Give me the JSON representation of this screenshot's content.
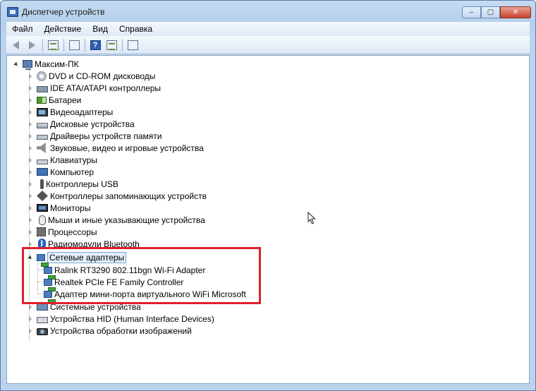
{
  "window": {
    "title": "Диспетчер устройств",
    "controls": {
      "minimize": "‒",
      "maximize": "▢",
      "close": "✕"
    }
  },
  "menu": [
    {
      "label": "Файл"
    },
    {
      "label": "Действие"
    },
    {
      "label": "Вид"
    },
    {
      "label": "Справка"
    }
  ],
  "toolbar": {
    "buttons": [
      "back-icon",
      "forward-icon",
      "show-hide-console-tree-icon",
      "properties-icon",
      "help-icon",
      "action-pane-icon",
      "scan-hardware-icon"
    ]
  },
  "tree": {
    "root": {
      "label": "Максим-ПК",
      "icon": "computer-icon"
    },
    "categories": [
      {
        "label": "DVD и CD-ROM дисководы",
        "icon": "dvd-drive-icon"
      },
      {
        "label": "IDE ATA/ATAPI контроллеры",
        "icon": "ide-controller-icon"
      },
      {
        "label": "Батареи",
        "icon": "battery-icon"
      },
      {
        "label": "Видеоадаптеры",
        "icon": "display-adapter-icon"
      },
      {
        "label": "Дисковые устройства",
        "icon": "disk-drive-icon"
      },
      {
        "label": "Драйверы устройств памяти",
        "icon": "memory-driver-icon"
      },
      {
        "label": "Звуковые, видео и игровые устройства",
        "icon": "sound-icon"
      },
      {
        "label": "Клавиатуры",
        "icon": "keyboard-icon"
      },
      {
        "label": "Компьютер",
        "icon": "pc-icon"
      },
      {
        "label": "Контроллеры USB",
        "icon": "usb-icon"
      },
      {
        "label": "Контроллеры запоминающих устройств",
        "icon": "storage-controller-icon"
      },
      {
        "label": "Мониторы",
        "icon": "monitor-icon"
      },
      {
        "label": "Мыши и иные указывающие устройства",
        "icon": "mouse-icon"
      },
      {
        "label": "Процессоры",
        "icon": "processor-icon"
      },
      {
        "label": "Радиомодули Bluetooth",
        "icon": "bluetooth-icon"
      }
    ],
    "network": {
      "label": "Сетевые адаптеры",
      "icon": "network-adapter-icon",
      "children": [
        {
          "label": "Ralink RT3290 802.11bgn Wi-Fi Adapter"
        },
        {
          "label": "Realtek PCIe FE Family Controller"
        },
        {
          "label": "Адаптер мини-порта виртуального WiFi Microsoft"
        }
      ]
    },
    "after": [
      {
        "label": "Системные устройства",
        "icon": "system-devices-icon"
      },
      {
        "label": "Устройства HID (Human Interface Devices)",
        "icon": "hid-icon"
      },
      {
        "label": "Устройства обработки изображений",
        "icon": "imaging-device-icon"
      }
    ]
  },
  "colors": {
    "highlight_box": "#e0202a",
    "selection_fill": "#e2eefb"
  }
}
